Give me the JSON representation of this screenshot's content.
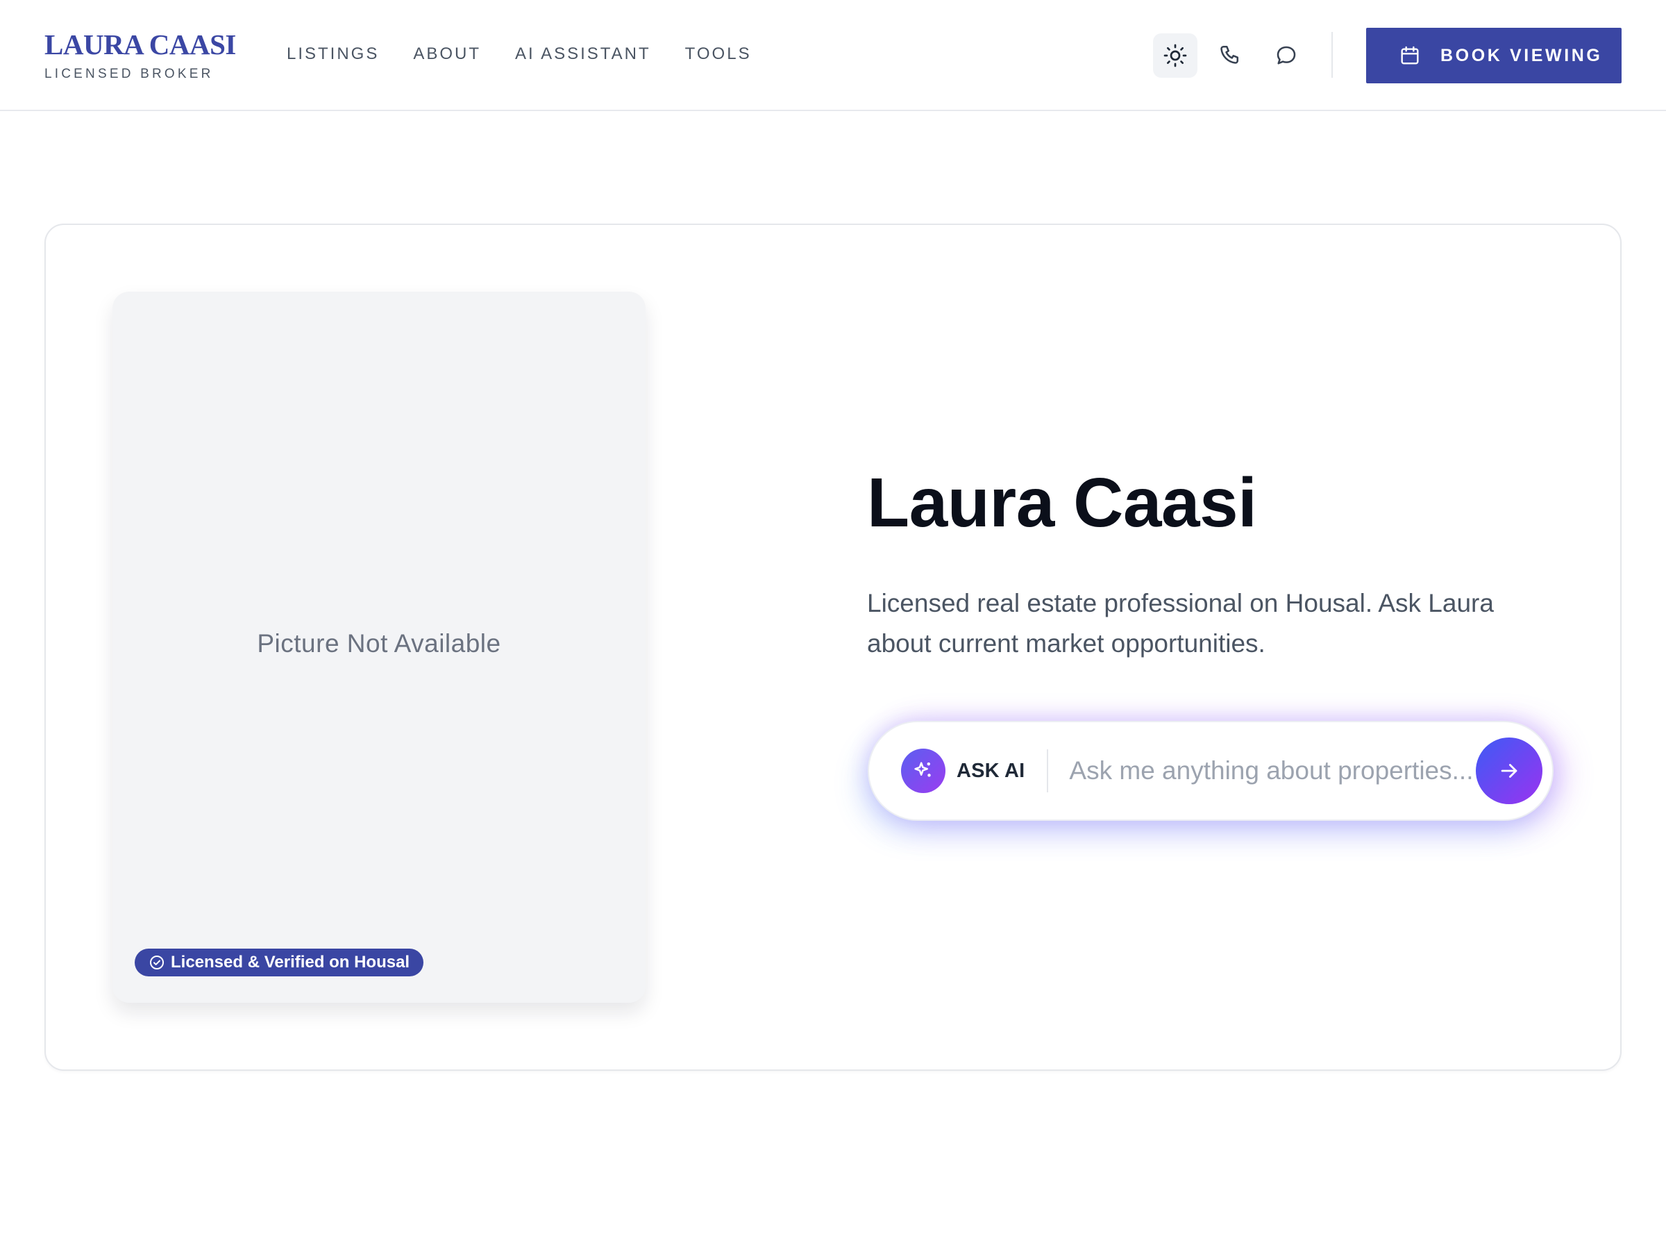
{
  "header": {
    "brand_name": "LAURA CAASI",
    "brand_subtitle": "LICENSED BROKER",
    "nav": [
      {
        "label": "LISTINGS"
      },
      {
        "label": "ABOUT"
      },
      {
        "label": "AI ASSISTANT"
      },
      {
        "label": "TOOLS"
      }
    ],
    "icons": [
      "sun-icon",
      "phone-icon",
      "chat-icon"
    ],
    "book_button_label": "BOOK VIEWING"
  },
  "profile": {
    "photo_placeholder": "Picture Not Available",
    "badge": "Licensed & Verified on Housal",
    "name": "Laura Caasi",
    "description": "Licensed real estate professional on Housal. Ask Laura about current market opportunities."
  },
  "ask_ai": {
    "label": "ASK AI",
    "placeholder": "Ask me anything about properties...",
    "value": ""
  },
  "colors": {
    "brand": "#3a46a3",
    "accent_gradient_start": "#3d5bf5",
    "accent_gradient_end": "#9a33f0"
  }
}
